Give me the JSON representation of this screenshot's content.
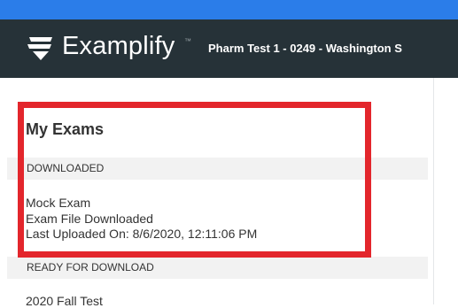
{
  "header": {
    "brand": "Examplify",
    "trademark": "™",
    "exam_title": "Pharm Test 1 - 0249 - Washington S"
  },
  "sidebar": {
    "heading": "My Exams",
    "downloaded_label": "DOWNLOADED",
    "downloaded_exam": {
      "name": "Mock Exam",
      "status": "Exam File Downloaded",
      "last_uploaded": "Last Uploaded On: 8/6/2020, 12:11:06 PM"
    },
    "ready_label": "READY FOR DOWNLOAD",
    "ready_exam": {
      "name": "2020 Fall Test"
    }
  },
  "colors": {
    "top_bar": "#2b7de9",
    "header_bg": "#263238",
    "highlight": "#e3262c"
  }
}
